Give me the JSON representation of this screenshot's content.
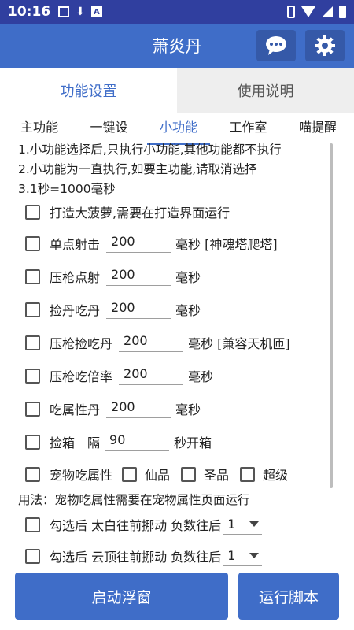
{
  "status": {
    "time": "10:16",
    "a_badge": "A"
  },
  "app": {
    "title": "萧炎丹"
  },
  "top_tabs": [
    {
      "label": "功能设置"
    },
    {
      "label": "使用说明"
    }
  ],
  "sub_tabs": [
    {
      "label": "主功能"
    },
    {
      "label": "一键设"
    },
    {
      "label": "小功能"
    },
    {
      "label": "工作室"
    },
    {
      "label": "喵提醒"
    }
  ],
  "notes": [
    "1.小功能选择后,只执行小功能,其他功能都不执行",
    "2.小功能为一直执行,如要主功能,请取消选择",
    "3.1秒=1000毫秒"
  ],
  "options": {
    "pineapple": {
      "label": "打造大菠萝,需要在打造界面运行"
    },
    "single_shot": {
      "label": "单点射击",
      "value": "200",
      "unit": "毫秒 [神魂塔爬塔]"
    },
    "recoil_shot": {
      "label": "压枪点射",
      "value": "200",
      "unit": "毫秒"
    },
    "pick_dan": {
      "label": "捡丹吃丹",
      "value": "200",
      "unit": "毫秒"
    },
    "recoil_pick": {
      "label": "压枪捡吃丹",
      "value": "200",
      "unit": "毫秒 [兼容天机匝]"
    },
    "recoil_multi": {
      "label": "压枪吃倍率",
      "value": "200",
      "unit": "毫秒"
    },
    "attr_dan": {
      "label": "吃属性丹",
      "value": "200",
      "unit": "毫秒"
    },
    "pick_box": {
      "label": "捡箱",
      "interval_label": "隔",
      "value": "90",
      "unit": "秒开箱"
    },
    "pet_attr": {
      "label": "宠物吃属性",
      "opt1": "仙品",
      "opt2": "圣品",
      "opt3": "超级"
    }
  },
  "usage_note": "用法：宠物吃属性需要在宠物属性页面运行",
  "moves": {
    "taibai": {
      "label": "勾选后 太白往前挪动 负数往后",
      "selected": "1"
    },
    "yunding": {
      "label": "勾选后 云顶往前挪动 负数往后",
      "selected": "1"
    }
  },
  "buttons": {
    "float": "启动浮窗",
    "run": "运行脚本"
  }
}
